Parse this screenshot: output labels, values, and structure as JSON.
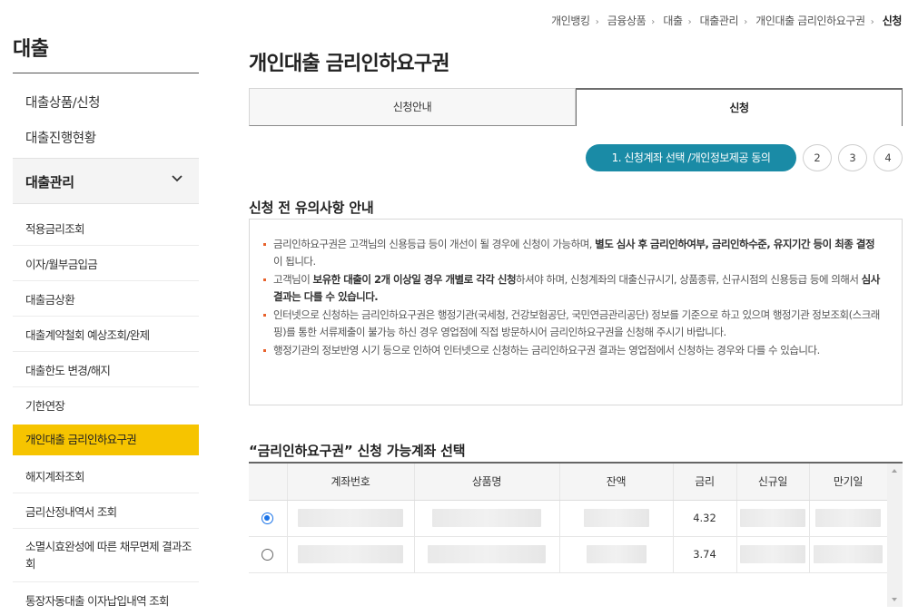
{
  "sidebar": {
    "title": "대출",
    "top_items": [
      "대출상품/신청",
      "대출진행현황"
    ],
    "group_label": "대출관리",
    "sub_items": [
      "적용금리조회",
      "이자/월부금입금",
      "대출금상환",
      "대출계약철회 예상조회/완제",
      "대출한도 변경/해지",
      "기한연장",
      "개인대출 금리인하요구권",
      "해지계좌조회",
      "금리산정내역서 조회",
      "소멸시효완성에 따른 채무면제 결과조회",
      "통장자동대출 이자납입내역 조회"
    ],
    "active_index": 6,
    "accent_color": "#f6c400"
  },
  "breadcrumb": [
    "개인뱅킹",
    "금융상품",
    "대출",
    "대출관리",
    "개인대출 금리인하요구권",
    "신청"
  ],
  "page_title": "개인대출 금리인하요구권",
  "tabs": [
    "신청안내",
    "신청"
  ],
  "steps": {
    "active_label": "1. 신청계좌 선택 /개인정보제공 동의",
    "others": [
      "2",
      "3",
      "4"
    ],
    "accent_color": "#1a8ba6"
  },
  "notice": {
    "title": "신청 전 유의사항 안내",
    "items": [
      {
        "parts": [
          {
            "t": "금리인하요구권은 고객님의 신용등급 등이 개선이 될 경우에 신청이 가능하며, ",
            "b": false
          },
          {
            "t": "별도 심사 후 금리인하여부, 금리인하수준, 유지기간 등이 최종 결정",
            "b": true
          },
          {
            "t": "이 됩니다.",
            "b": false
          }
        ]
      },
      {
        "parts": [
          {
            "t": "고객님이 ",
            "b": false
          },
          {
            "t": "보유한 대출이 2개 이상일 경우 개별로 각각 신청",
            "b": true
          },
          {
            "t": "하셔야 하며, 신청계좌의 대출신규시기, 상품종류, 신규시점의 신용등급 등에 의해서 ",
            "b": false
          },
          {
            "t": "심사결과는 다를 수 있습니다.",
            "b": true
          }
        ]
      },
      {
        "parts": [
          {
            "t": "인터넷으로 신청하는 금리인하요구권은 행정기관(국세청, 건강보험공단, 국민연금관리공단) 정보를 기준으로 하고 있으며 행정기관 정보조회(스크래핑)를 통한 서류제출이 불가능 하신 경우 영업점에 직접 방문하시어 금리인하요구권을 신청해 주시기 바랍니다.",
            "b": false
          }
        ]
      },
      {
        "parts": [
          {
            "t": "행정기관의 정보반영 시기 등으로 인하여 인터넷으로 신청하는 금리인하요구권 결과는 영업점에서 신청하는 경우와 다를 수 있습니다.",
            "b": false
          }
        ]
      }
    ]
  },
  "accounts": {
    "title": "“금리인하요구권” 신청 가능계좌 선택",
    "headers": [
      "",
      "계좌번호",
      "상품명",
      "잔액",
      "금리",
      "신규일",
      "만기일"
    ],
    "rows": [
      {
        "selected": true,
        "rate": "4.32"
      },
      {
        "selected": false,
        "rate": "3.74"
      }
    ]
  }
}
